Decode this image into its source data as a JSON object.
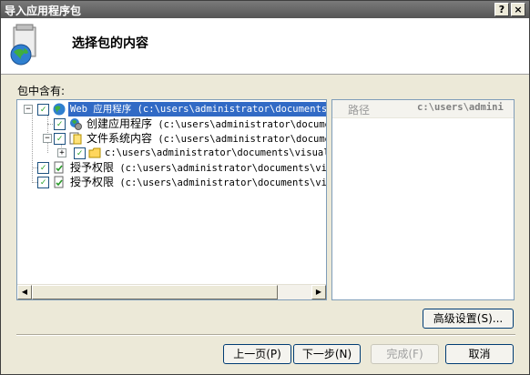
{
  "window": {
    "title": "导入应用程序包",
    "help_label": "?",
    "close_label": "×"
  },
  "header": {
    "title": "选择包的内容",
    "icon": "package-globe-icon"
  },
  "contents_label": "包中含有:",
  "tree": {
    "items": [
      {
        "label": "Web 应用程序 (c:\\users\\administrator\\documents\\",
        "expander": "−",
        "checked": true,
        "icon": "globe-icon",
        "selected": true
      },
      {
        "label_cn": "创建应用程序",
        "label_path": " (c:\\users\\administrator\\document",
        "checked": true,
        "icon": "app-gear-icon"
      },
      {
        "label_cn": "文件系统内容",
        "label_path": " (c:\\users\\administrator\\documen",
        "expander": "−",
        "checked": true,
        "icon": "file-system-icon"
      },
      {
        "label": "c:\\users\\administrator\\documents\\visual s",
        "expander": "+",
        "checked": true,
        "icon": "folder-icon"
      },
      {
        "label_cn": "授予权限",
        "label_path": " (c:\\users\\administrator\\documents\\visu",
        "checked": true,
        "icon": "permission-icon"
      },
      {
        "label_cn": "授予权限",
        "label_path": " (c:\\users\\administrator\\documents\\visu",
        "checked": true,
        "icon": "permission-icon"
      }
    ],
    "scroll_left": "◀",
    "scroll_right": "▶"
  },
  "properties": {
    "name": "路径",
    "value": "c:\\users\\admini"
  },
  "buttons": {
    "advanced": "高级设置(S)...",
    "back": "上一页(P)",
    "next": "下一步(N)",
    "finish": "完成(F)",
    "cancel": "取消"
  }
}
